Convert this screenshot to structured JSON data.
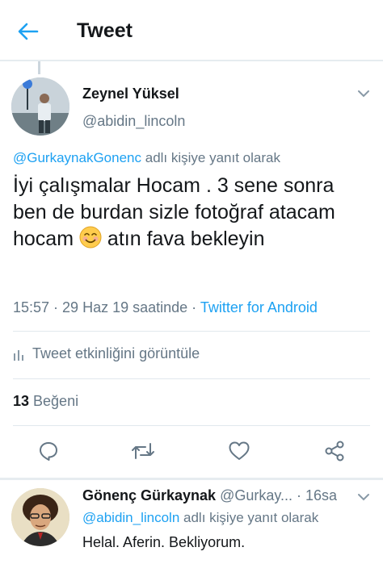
{
  "header": {
    "title": "Tweet",
    "back_icon": "arrow-left-icon"
  },
  "colors": {
    "accent": "#1da1f2",
    "secondary_text": "#657786",
    "primary_text": "#14171a",
    "divider": "#e1e8ed"
  },
  "tweet": {
    "author_name": "Zeynel Yüksel",
    "author_handle": "@abidin_lincoln",
    "reply_to_mention": "@GurkaynakGonenc",
    "reply_to_suffix": " adlı kişiye yanıt olarak",
    "text_before_emoji": "İyi çalışmalar Hocam . 3 sene sonra ben de burdan sizle fotoğraf atacam hocam ",
    "emoji": "smiling-face-emoji",
    "text_after_emoji": " atın fava bekleyin",
    "time": "15:57",
    "separator": " · ",
    "date": "29 Haz 19 saatinde",
    "source": "Twitter for Android",
    "activity_label": "Tweet etkinliğini görüntüle",
    "like_count": "13",
    "like_label": " Beğeni"
  },
  "actions": [
    {
      "name": "reply-icon"
    },
    {
      "name": "retweet-icon"
    },
    {
      "name": "like-icon"
    },
    {
      "name": "share-icon"
    }
  ],
  "reply": {
    "author_name": "Gönenç Gürkaynak",
    "author_handle": " @Gurkay...",
    "time": " · 16sa",
    "reply_to_mention": "@abidin_lincoln",
    "reply_to_suffix": " adlı kişiye yanıt olarak",
    "text": "Helal. Aferin. Bekliyorum."
  }
}
